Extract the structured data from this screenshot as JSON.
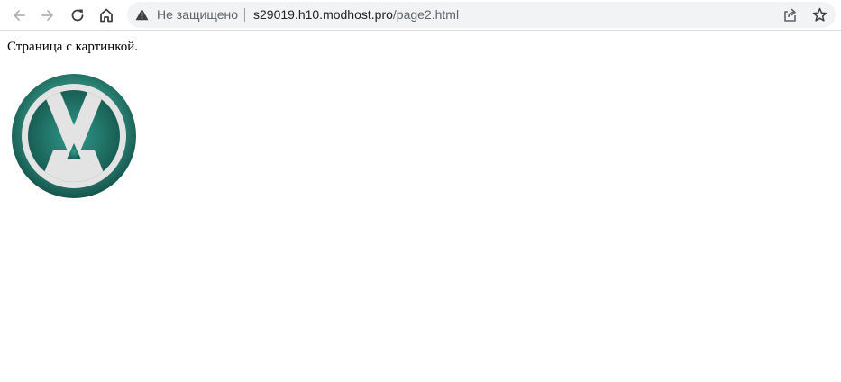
{
  "browser": {
    "security_text": "Не защищено",
    "url_host": "s29019.h10.modhost.pro",
    "url_path": "/page2.html",
    "icons": {
      "back": "arrow-left-icon",
      "forward": "arrow-right-icon",
      "reload": "reload-icon",
      "home": "home-icon",
      "warning": "warning-triangle-icon",
      "share": "share-icon",
      "bookmark": "star-icon"
    }
  },
  "page": {
    "text": "Страница с картинкой.",
    "image": {
      "name": "logo-image",
      "colors": {
        "ring": "#1f6f66",
        "letter": "#e2e2e2",
        "inner": "#2a8a7c"
      }
    }
  }
}
